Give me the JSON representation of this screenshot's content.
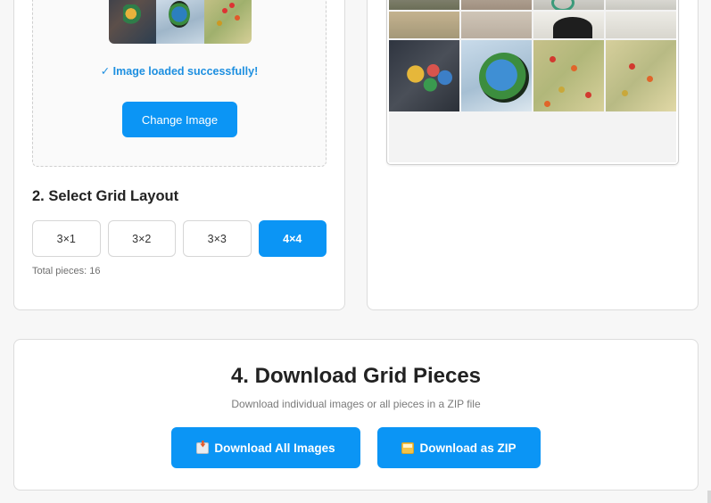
{
  "upload": {
    "status": "✓ Image loaded successfully!",
    "change_button": "Change Image"
  },
  "grid_layout": {
    "heading": "2. Select Grid Layout",
    "options": [
      "3×1",
      "3×2",
      "3×3",
      "4×4"
    ],
    "selected": "4×4",
    "total_pieces": "Total pieces: 16"
  },
  "download": {
    "title": "4. Download Grid Pieces",
    "subtitle": "Download individual images or all pieces in a ZIP file",
    "all_button": "Download All Images",
    "zip_button": "Download as ZIP"
  },
  "colors": {
    "accent": "#0b95f5",
    "status": "#1d8fe0"
  }
}
